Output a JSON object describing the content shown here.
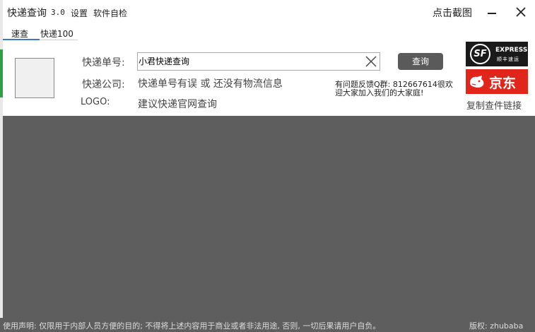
{
  "titlebar": {
    "app_title": "快递查询",
    "version": "3.0",
    "menu_settings": "设置",
    "menu_selfcheck": "软件自检",
    "screenshot_label": "点击截图"
  },
  "tabs": [
    {
      "label": "速查",
      "active": true
    },
    {
      "label": "快递100",
      "active": false
    }
  ],
  "form": {
    "tracking_label": "快递单号:",
    "tracking_value": "小君快递查询",
    "company_label": "快递公司:",
    "company_value": "快递单号有误 或 还没有物流信息",
    "logo_label": "LOGO:",
    "logo_value": "建议快递官网查询",
    "query_button": "查询"
  },
  "feedback": {
    "line1": "有问题反馈Q群: 812667614很欢",
    "line2": "迎大家加入我们的大家庭!"
  },
  "carriers": {
    "sf": {
      "mark": "SF",
      "express": "EXPRESS",
      "cn": "顺丰速运",
      "color": "#1a1a1a"
    },
    "jd": {
      "text": "京东",
      "color": "#e1251b"
    }
  },
  "copy_link": "复制查件链接",
  "statusbar": {
    "disclaimer": "使用声明: 仅限用于内部人员方便的目的; 不得将上述内容用于商业或者非法用途, 否则, 一切后果请用户自负。",
    "copyright": "版权: zhubaba"
  },
  "colors": {
    "accent": "#3a78c2",
    "background": "#5e5e5e",
    "button": "#5a5a5a"
  }
}
